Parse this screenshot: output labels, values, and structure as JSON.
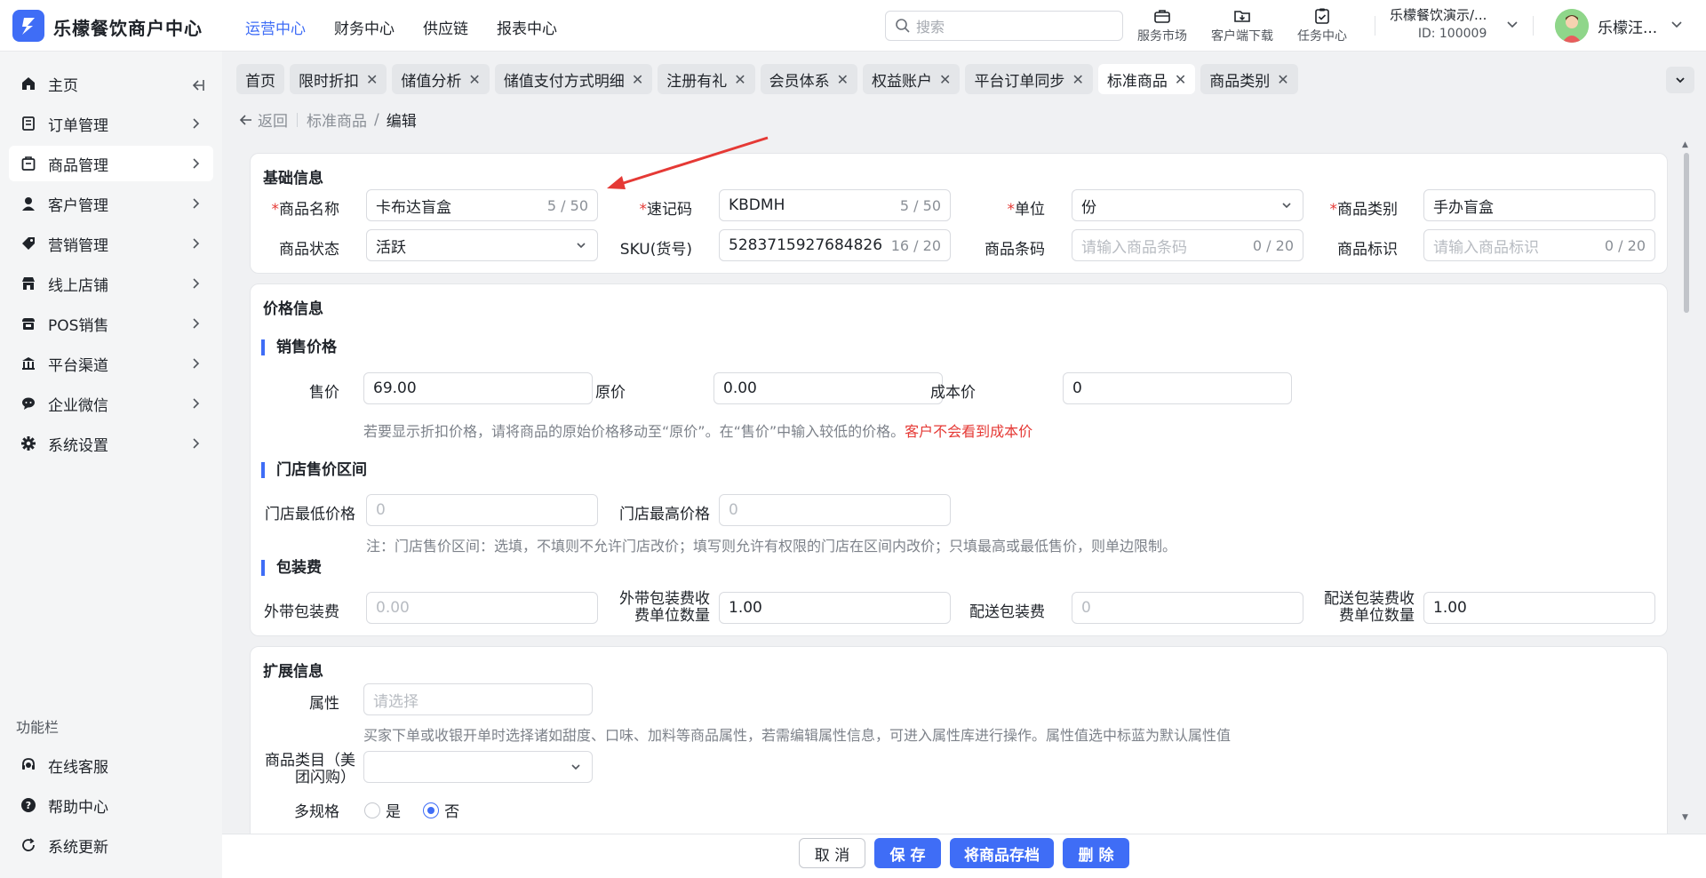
{
  "app": {
    "brand": "乐檬餐饮商户中心"
  },
  "topnav": [
    {
      "label": "运营中心",
      "active": true
    },
    {
      "label": "财务中心"
    },
    {
      "label": "供应链"
    },
    {
      "label": "报表中心"
    }
  ],
  "search": {
    "placeholder": "搜索"
  },
  "tools": {
    "market": "服务市场",
    "download": "客户端下载",
    "tasks": "任务中心"
  },
  "store": {
    "name": "乐檬餐饮演示/...",
    "id": "ID: 100009"
  },
  "user": {
    "name": "乐檬汪..."
  },
  "sidebar": {
    "items": [
      {
        "label": "主页"
      },
      {
        "label": "订单管理"
      },
      {
        "label": "商品管理"
      },
      {
        "label": "客户管理"
      },
      {
        "label": "营销管理"
      },
      {
        "label": "线上店铺"
      },
      {
        "label": "POS销售"
      },
      {
        "label": "平台渠道"
      },
      {
        "label": "企业微信"
      },
      {
        "label": "系统设置"
      }
    ],
    "section": "功能栏",
    "bottom": [
      {
        "label": "在线客服"
      },
      {
        "label": "帮助中心"
      },
      {
        "label": "系统更新"
      }
    ]
  },
  "tabs": [
    {
      "label": "首页"
    },
    {
      "label": "限时折扣"
    },
    {
      "label": "储值分析"
    },
    {
      "label": "储值支付方式明细"
    },
    {
      "label": "注册有礼"
    },
    {
      "label": "会员体系"
    },
    {
      "label": "权益账户"
    },
    {
      "label": "平台订单同步"
    },
    {
      "label": "标准商品"
    },
    {
      "label": "商品类别"
    }
  ],
  "breadcrumb": {
    "back": "返回",
    "parent": "标准商品",
    "sep": "/",
    "current": "编辑"
  },
  "basic": {
    "title": "基础信息",
    "name_label": "商品名称",
    "name_value": "卡布达盲盒",
    "name_count": "5 / 50",
    "code_label": "速记码",
    "code_value": "KBDMH",
    "code_count": "5 / 50",
    "unit_label": "单位",
    "unit_value": "份",
    "cat_label": "商品类别",
    "cat_value": "手办盲盒",
    "status_label": "商品状态",
    "status_value": "活跃",
    "sku_label": "SKU(货号)",
    "sku_value": "5283715927684826",
    "sku_count": "16 / 20",
    "barcode_label": "商品条码",
    "barcode_ph": "请输入商品条码",
    "barcode_count": "0 / 20",
    "mark_label": "商品标识",
    "mark_ph": "请输入商品标识",
    "mark_count": "0 / 20"
  },
  "price": {
    "title": "价格信息",
    "sale_title": "销售价格",
    "sale_label": "售价",
    "sale_value": "69.00",
    "orig_label": "原价",
    "orig_value": "0.00",
    "cost_label": "成本价",
    "cost_value": "0",
    "hint": "若要显示折扣价格，请将商品的原始价格移动至“原价”。在“售价”中输入较低的价格。",
    "hint_red": "客户不会看到成本价",
    "range_title": "门店售价区间",
    "min_label": "门店最低价格",
    "min_ph": "0",
    "max_label": "门店最高价格",
    "max_ph": "0",
    "range_hint": "注：门店售价区间：选填，不填则不允许门店改价；填写则允许有权限的门店在区间内改价；只填最高或最低售价，则单边限制。",
    "pack_title": "包装费",
    "take_label": "外带包装费",
    "take_ph": "0.00",
    "take_unit_label1": "外带包装费收",
    "take_unit_label2": "费单位数量",
    "take_unit_value": "1.00",
    "deliv_label": "配送包装费",
    "deliv_ph": "0",
    "deliv_unit_label1": "配送包装费收",
    "deliv_unit_label2": "费单位数量",
    "deliv_unit_value": "1.00"
  },
  "ext": {
    "title": "扩展信息",
    "attr_label": "属性",
    "attr_ph": "请选择",
    "attr_hint": "买家下单或收银开单时选择诸如甜度、口味、加料等商品属性，若需编辑属性信息，可进入属性库进行操作。属性值选中标蓝为默认属性值",
    "meituan_label1": "商品类目（美",
    "meituan_label2": "团闪购）",
    "spec_label": "多规格",
    "spec_yes": "是",
    "spec_no": "否",
    "spec_selected": "否"
  },
  "actions": {
    "cancel": "取 消",
    "save": "保 存",
    "archive": "将商品存档",
    "delete": "删 除"
  },
  "colors": {
    "accent": "#3f6df6",
    "required": "#e53935",
    "annotation_arrow": "#e53935"
  }
}
